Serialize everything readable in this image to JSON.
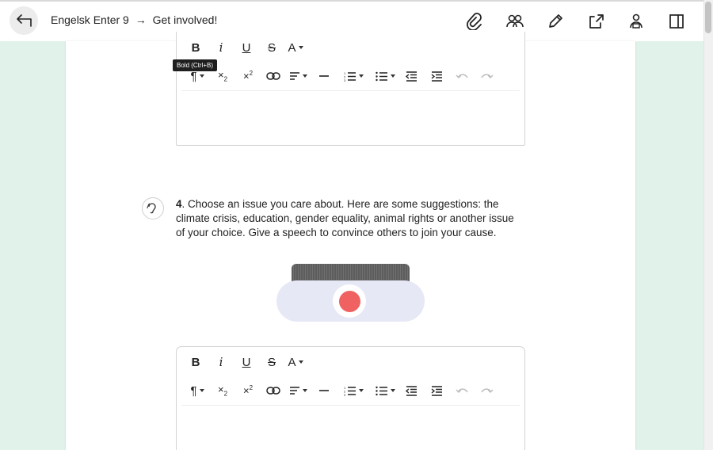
{
  "header": {
    "back_icon": "back-arrow-icon",
    "breadcrumb_parent": "Engelsk Enter 9",
    "breadcrumb_separator": "→",
    "breadcrumb_current": "Get involved!",
    "actions": [
      {
        "name": "attachment-icon"
      },
      {
        "name": "group-icon"
      },
      {
        "name": "pencil-icon"
      },
      {
        "name": "share-icon"
      },
      {
        "name": "teacher-icon"
      },
      {
        "name": "sidebar-panel-icon"
      }
    ]
  },
  "editor_top": {
    "bold": "B",
    "italic": "i",
    "underline": "U",
    "strike": "S",
    "font": "A",
    "tooltip": "Bold (Ctrl+B)"
  },
  "question": {
    "number": "4",
    "text": ". Choose an issue you care about. Here are some suggestions: the climate crisis, education, gender equality, animal rights or another issue of your choice. Give a speech to convince others to join your cause."
  },
  "editor_bottom": {
    "bold": "B",
    "italic": "i",
    "underline": "U",
    "strike": "S",
    "font": "A"
  },
  "colors": {
    "background": "#e0f2ea",
    "record_button": "#f06262",
    "recorder_body": "#e6e8f5"
  }
}
